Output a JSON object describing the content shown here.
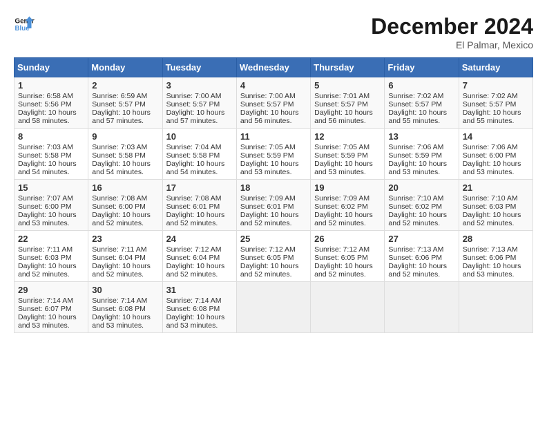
{
  "header": {
    "logo_line1": "General",
    "logo_line2": "Blue",
    "title": "December 2024",
    "subtitle": "El Palmar, Mexico"
  },
  "calendar": {
    "headers": [
      "Sunday",
      "Monday",
      "Tuesday",
      "Wednesday",
      "Thursday",
      "Friday",
      "Saturday"
    ],
    "weeks": [
      [
        {
          "day": "",
          "info": ""
        },
        {
          "day": "",
          "info": ""
        },
        {
          "day": "",
          "info": ""
        },
        {
          "day": "",
          "info": ""
        },
        {
          "day": "",
          "info": ""
        },
        {
          "day": "",
          "info": ""
        },
        {
          "day": "",
          "info": ""
        }
      ]
    ],
    "cells": [
      {
        "day": "1",
        "sunrise": "6:58 AM",
        "sunset": "5:56 PM",
        "daylight": "10 hours and 58 minutes."
      },
      {
        "day": "2",
        "sunrise": "6:59 AM",
        "sunset": "5:57 PM",
        "daylight": "10 hours and 57 minutes."
      },
      {
        "day": "3",
        "sunrise": "7:00 AM",
        "sunset": "5:57 PM",
        "daylight": "10 hours and 57 minutes."
      },
      {
        "day": "4",
        "sunrise": "7:00 AM",
        "sunset": "5:57 PM",
        "daylight": "10 hours and 56 minutes."
      },
      {
        "day": "5",
        "sunrise": "7:01 AM",
        "sunset": "5:57 PM",
        "daylight": "10 hours and 56 minutes."
      },
      {
        "day": "6",
        "sunrise": "7:02 AM",
        "sunset": "5:57 PM",
        "daylight": "10 hours and 55 minutes."
      },
      {
        "day": "7",
        "sunrise": "7:02 AM",
        "sunset": "5:57 PM",
        "daylight": "10 hours and 55 minutes."
      },
      {
        "day": "8",
        "sunrise": "7:03 AM",
        "sunset": "5:58 PM",
        "daylight": "10 hours and 54 minutes."
      },
      {
        "day": "9",
        "sunrise": "7:03 AM",
        "sunset": "5:58 PM",
        "daylight": "10 hours and 54 minutes."
      },
      {
        "day": "10",
        "sunrise": "7:04 AM",
        "sunset": "5:58 PM",
        "daylight": "10 hours and 54 minutes."
      },
      {
        "day": "11",
        "sunrise": "7:05 AM",
        "sunset": "5:59 PM",
        "daylight": "10 hours and 53 minutes."
      },
      {
        "day": "12",
        "sunrise": "7:05 AM",
        "sunset": "5:59 PM",
        "daylight": "10 hours and 53 minutes."
      },
      {
        "day": "13",
        "sunrise": "7:06 AM",
        "sunset": "5:59 PM",
        "daylight": "10 hours and 53 minutes."
      },
      {
        "day": "14",
        "sunrise": "7:06 AM",
        "sunset": "6:00 PM",
        "daylight": "10 hours and 53 minutes."
      },
      {
        "day": "15",
        "sunrise": "7:07 AM",
        "sunset": "6:00 PM",
        "daylight": "10 hours and 53 minutes."
      },
      {
        "day": "16",
        "sunrise": "7:08 AM",
        "sunset": "6:00 PM",
        "daylight": "10 hours and 52 minutes."
      },
      {
        "day": "17",
        "sunrise": "7:08 AM",
        "sunset": "6:01 PM",
        "daylight": "10 hours and 52 minutes."
      },
      {
        "day": "18",
        "sunrise": "7:09 AM",
        "sunset": "6:01 PM",
        "daylight": "10 hours and 52 minutes."
      },
      {
        "day": "19",
        "sunrise": "7:09 AM",
        "sunset": "6:02 PM",
        "daylight": "10 hours and 52 minutes."
      },
      {
        "day": "20",
        "sunrise": "7:10 AM",
        "sunset": "6:02 PM",
        "daylight": "10 hours and 52 minutes."
      },
      {
        "day": "21",
        "sunrise": "7:10 AM",
        "sunset": "6:03 PM",
        "daylight": "10 hours and 52 minutes."
      },
      {
        "day": "22",
        "sunrise": "7:11 AM",
        "sunset": "6:03 PM",
        "daylight": "10 hours and 52 minutes."
      },
      {
        "day": "23",
        "sunrise": "7:11 AM",
        "sunset": "6:04 PM",
        "daylight": "10 hours and 52 minutes."
      },
      {
        "day": "24",
        "sunrise": "7:12 AM",
        "sunset": "6:04 PM",
        "daylight": "10 hours and 52 minutes."
      },
      {
        "day": "25",
        "sunrise": "7:12 AM",
        "sunset": "6:05 PM",
        "daylight": "10 hours and 52 minutes."
      },
      {
        "day": "26",
        "sunrise": "7:12 AM",
        "sunset": "6:05 PM",
        "daylight": "10 hours and 52 minutes."
      },
      {
        "day": "27",
        "sunrise": "7:13 AM",
        "sunset": "6:06 PM",
        "daylight": "10 hours and 52 minutes."
      },
      {
        "day": "28",
        "sunrise": "7:13 AM",
        "sunset": "6:06 PM",
        "daylight": "10 hours and 53 minutes."
      },
      {
        "day": "29",
        "sunrise": "7:14 AM",
        "sunset": "6:07 PM",
        "daylight": "10 hours and 53 minutes."
      },
      {
        "day": "30",
        "sunrise": "7:14 AM",
        "sunset": "6:08 PM",
        "daylight": "10 hours and 53 minutes."
      },
      {
        "day": "31",
        "sunrise": "7:14 AM",
        "sunset": "6:08 PM",
        "daylight": "10 hours and 53 minutes."
      }
    ]
  }
}
